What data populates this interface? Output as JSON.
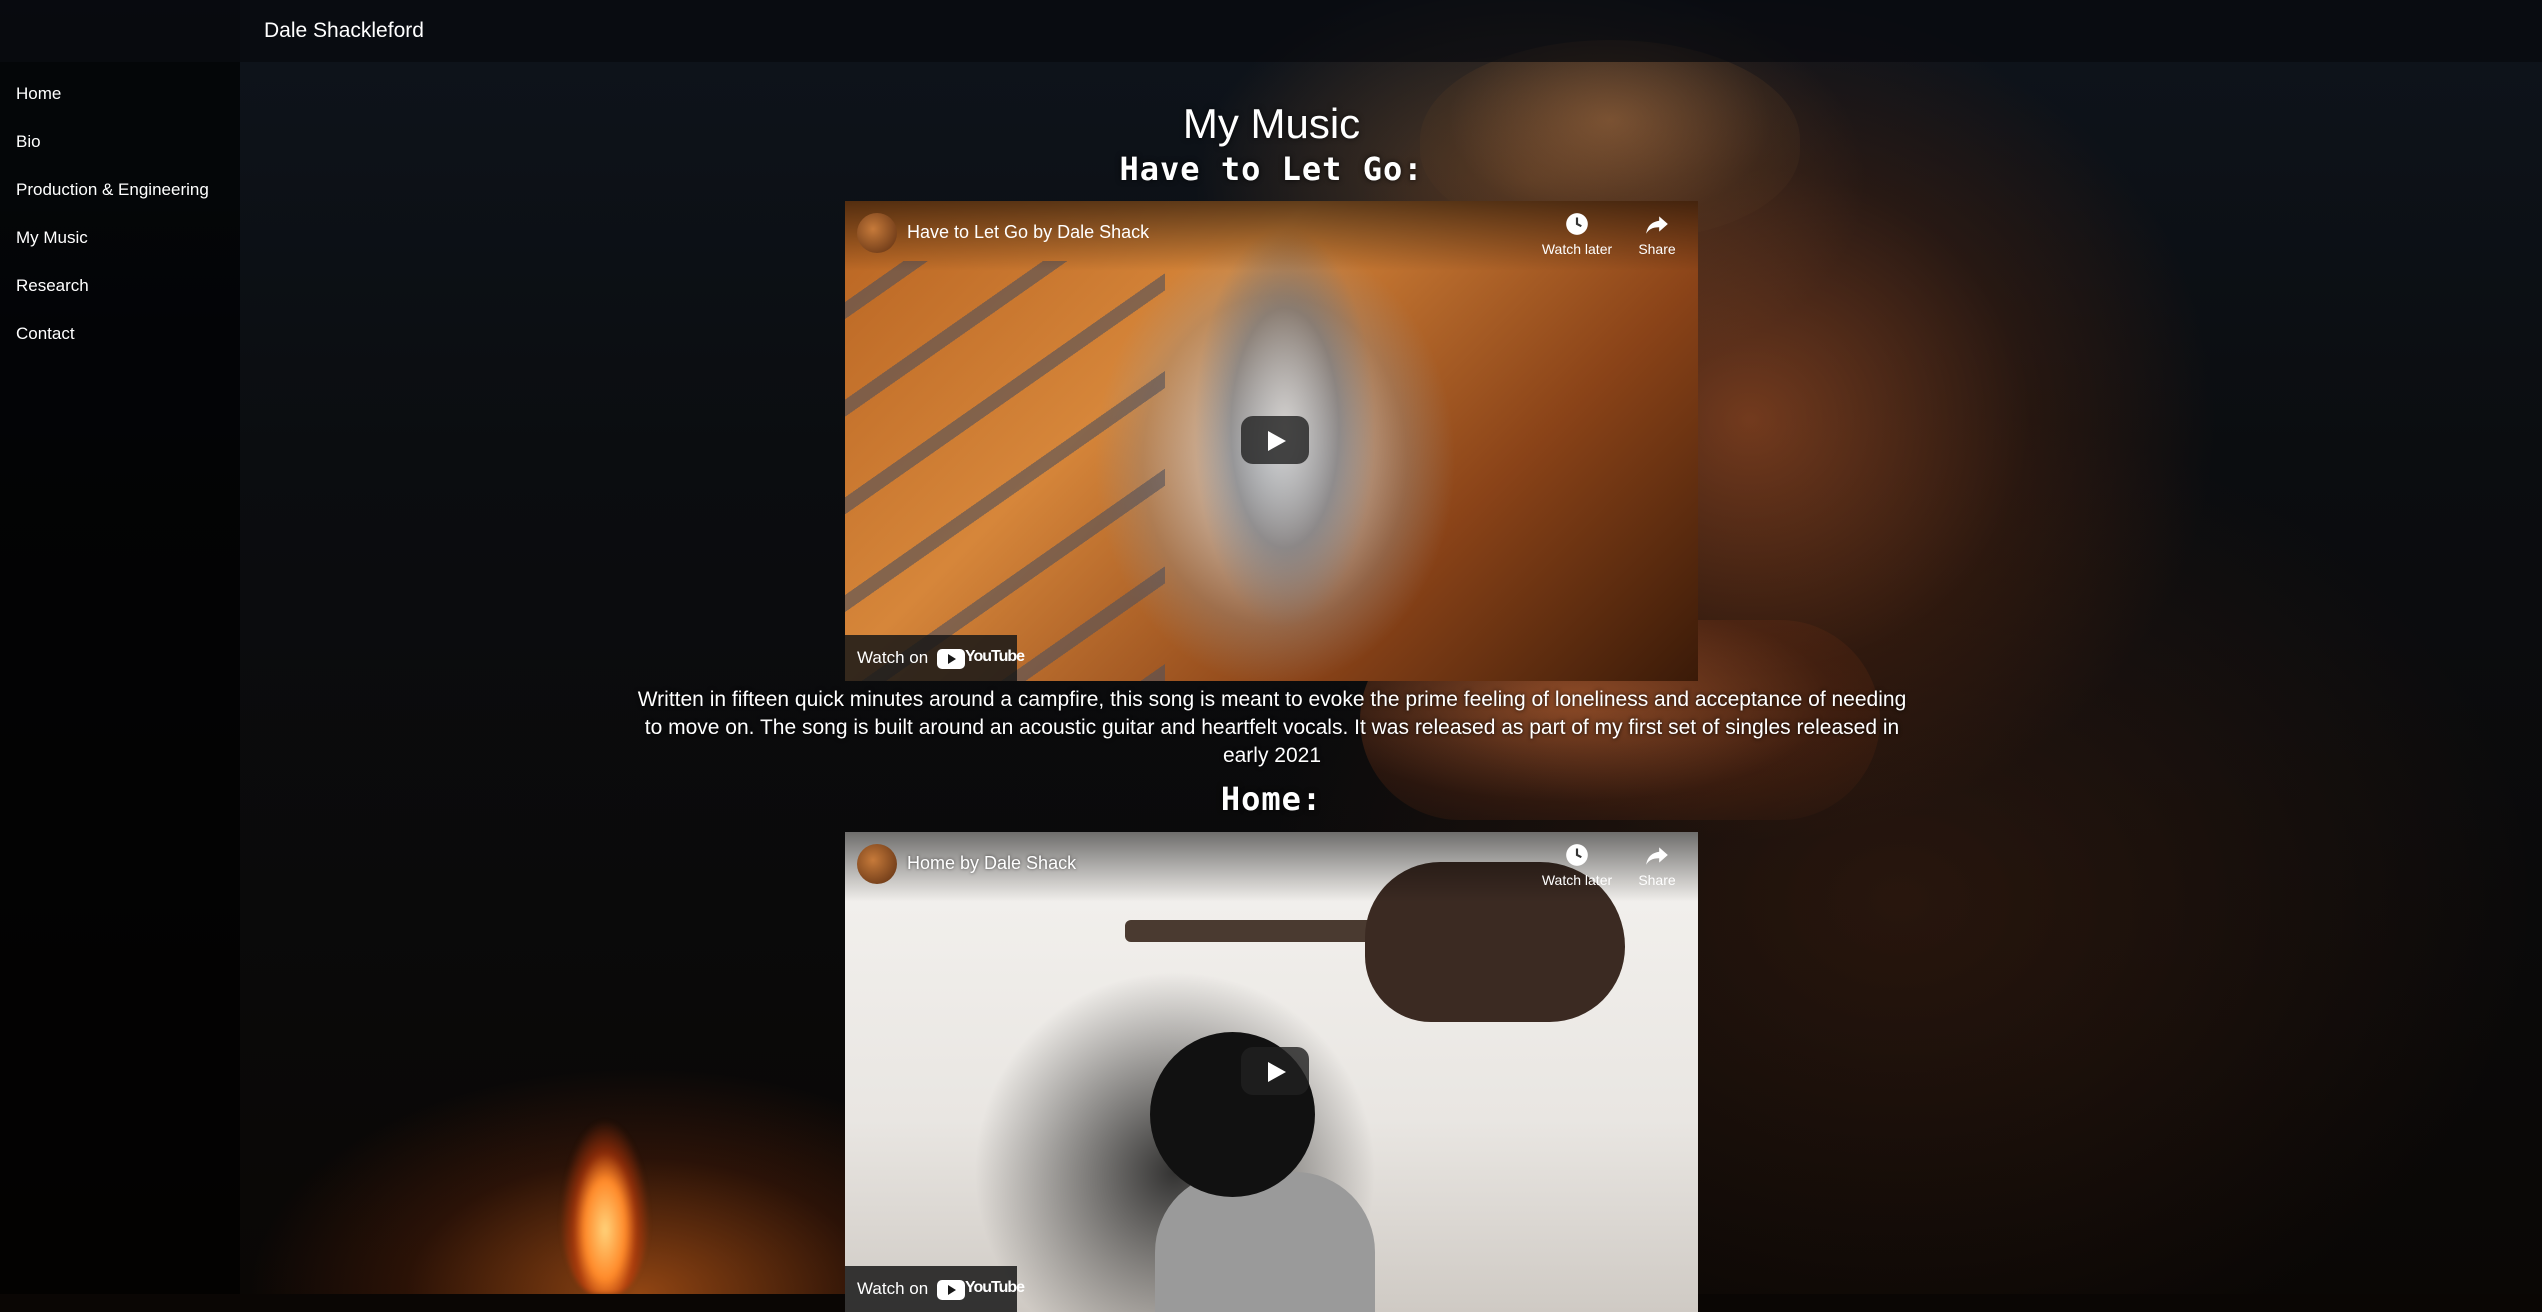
{
  "site": {
    "brand": "Dale Shackleford"
  },
  "sidebar": {
    "items": [
      {
        "label": "Home"
      },
      {
        "label": "Bio"
      },
      {
        "label": "Production & Engineering"
      },
      {
        "label": "My Music"
      },
      {
        "label": "Research"
      },
      {
        "label": "Contact"
      }
    ]
  },
  "main": {
    "title": "My Music",
    "songs": [
      {
        "title": "Have to Let Go:",
        "video": {
          "title": "Have to Let Go by Dale Shack",
          "watch_later": "Watch later",
          "share": "Share",
          "watch_on": "Watch on",
          "platform": "YouTube"
        },
        "description": "Written in fifteen quick minutes around a campfire, this song is meant to evoke the prime feeling of loneliness and acceptance of needing to move on. The song is built around an acoustic guitar and heartfelt vocals. It was released as part of my first set of singles released in early 2021"
      },
      {
        "title": "Home:",
        "video": {
          "title": "Home by Dale Shack",
          "watch_later": "Watch later",
          "share": "Share",
          "watch_on": "Watch on",
          "platform": "YouTube"
        }
      }
    ]
  },
  "colors": {
    "youtube_red": "#ff0000",
    "overlay": "#171717"
  },
  "icons": [
    "clock-icon",
    "share-arrow-icon",
    "play-icon",
    "youtube-logo-icon"
  ]
}
